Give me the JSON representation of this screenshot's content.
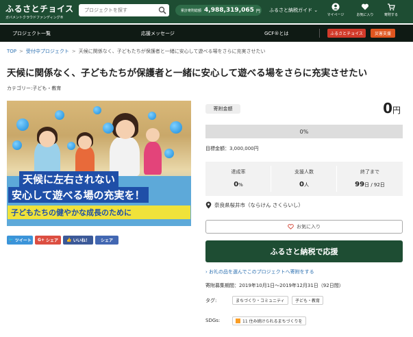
{
  "header": {
    "logo_main": "ふるさとチョイス",
    "logo_sub": "ガバメントクラウドファンディング®",
    "search_placeholder": "プロジェクトを探す",
    "total_label": "累計寄附総額",
    "total_value": "4,988,319,065",
    "total_unit": "円",
    "guide_label": "ふるさと納税ガイド ⌄",
    "icons": [
      {
        "label": "マイページ",
        "icon": "user-icon"
      },
      {
        "label": "お気に入り",
        "icon": "heart-icon"
      },
      {
        "label": "寄附する",
        "icon": "cart-icon"
      }
    ]
  },
  "nav": {
    "items": [
      "プロジェクト一覧",
      "応援メッセージ",
      "GCF®とは"
    ],
    "btn_choice": "ふるさとチョイス",
    "btn_disaster": "災害支援"
  },
  "breadcrumb": [
    "TOP",
    "受付中プロジェクト",
    "天候に関係なく、子どもたちが保護者と一緒に安心して遊べる場をさらに充実させたい"
  ],
  "project": {
    "title": "天候に関係なく、子どもたちが保護者と一緒に安心して遊べる場をさらに充実させたい",
    "category": "カテゴリー:子ども・教育",
    "banner_line1": "天候に左右されない",
    "banner_line2": "安心して遊べる場の充実を！",
    "banner_line3": "子どもたちの健やかな成長のために"
  },
  "share": {
    "tweet": "ツイート",
    "gplus": "シェア",
    "like": "いいね！",
    "fb_share": "シェア"
  },
  "funding": {
    "amount_label": "寄附金額",
    "amount": "0",
    "amount_unit": "円",
    "progress_text": "0%",
    "progress_fraction": 0,
    "goal": "目標金額：3,000,000円",
    "stats": [
      {
        "label": "達成率",
        "value": "0",
        "unit": "%"
      },
      {
        "label": "支援人数",
        "value": "0",
        "unit": "人"
      },
      {
        "label": "終了まで",
        "value": "99",
        "unit": "日 / 92日"
      }
    ],
    "location": "奈良県桜井市（ならけん さくらいし）",
    "fav_label": "お気に入り",
    "cta_label": "ふるさと納税で応援",
    "gift_link": "お礼の品を選んでこのプロジェクトへ寄附をする",
    "period": "寄附募集期間：2019年10月1日～2019年12月31日（92日間）",
    "tags_label": "タグ:",
    "tags": [
      "まちづくり・コミュニティ",
      "子ども・教育"
    ],
    "sdgs_label": "SDGs:",
    "sdgs": [
      "11 住み続けられるまちづくりを"
    ]
  },
  "colors": {
    "brand_green": "#1e4d33",
    "nav_dark": "#0f1a14",
    "accent_red": "#d13a2a",
    "link_blue": "#2a6fb0"
  }
}
